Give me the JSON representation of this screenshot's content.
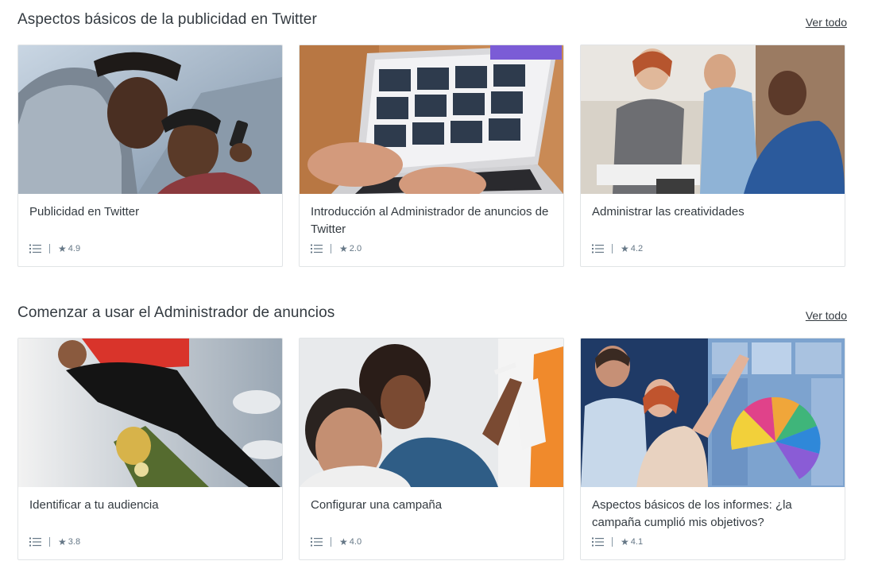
{
  "sections": [
    {
      "title": "Aspectos básicos de la publicidad en Twitter",
      "see_all": "Ver todo",
      "cards": [
        {
          "title": "Publicidad en Twitter",
          "rating": "4.9"
        },
        {
          "title": "Introducción al Administrador de anuncios de Twitter",
          "rating": "2.0"
        },
        {
          "title": "Administrar las creatividades",
          "rating": "4.2"
        }
      ]
    },
    {
      "title": "Comenzar a usar el Administrador de anuncios",
      "see_all": "Ver todo",
      "cards": [
        {
          "title": "Identificar a tu audiencia",
          "rating": "3.8"
        },
        {
          "title": "Configurar una campaña",
          "rating": "4.0"
        },
        {
          "title": "Aspectos básicos de los informes: ¿la campaña cumplió mis objetivos?",
          "rating": "4.1"
        }
      ]
    }
  ],
  "icons": {
    "list": "list-icon",
    "star": "star-icon"
  },
  "colors": {
    "text": "#333a40",
    "meta": "#657786",
    "border": "#e1e4e6"
  }
}
